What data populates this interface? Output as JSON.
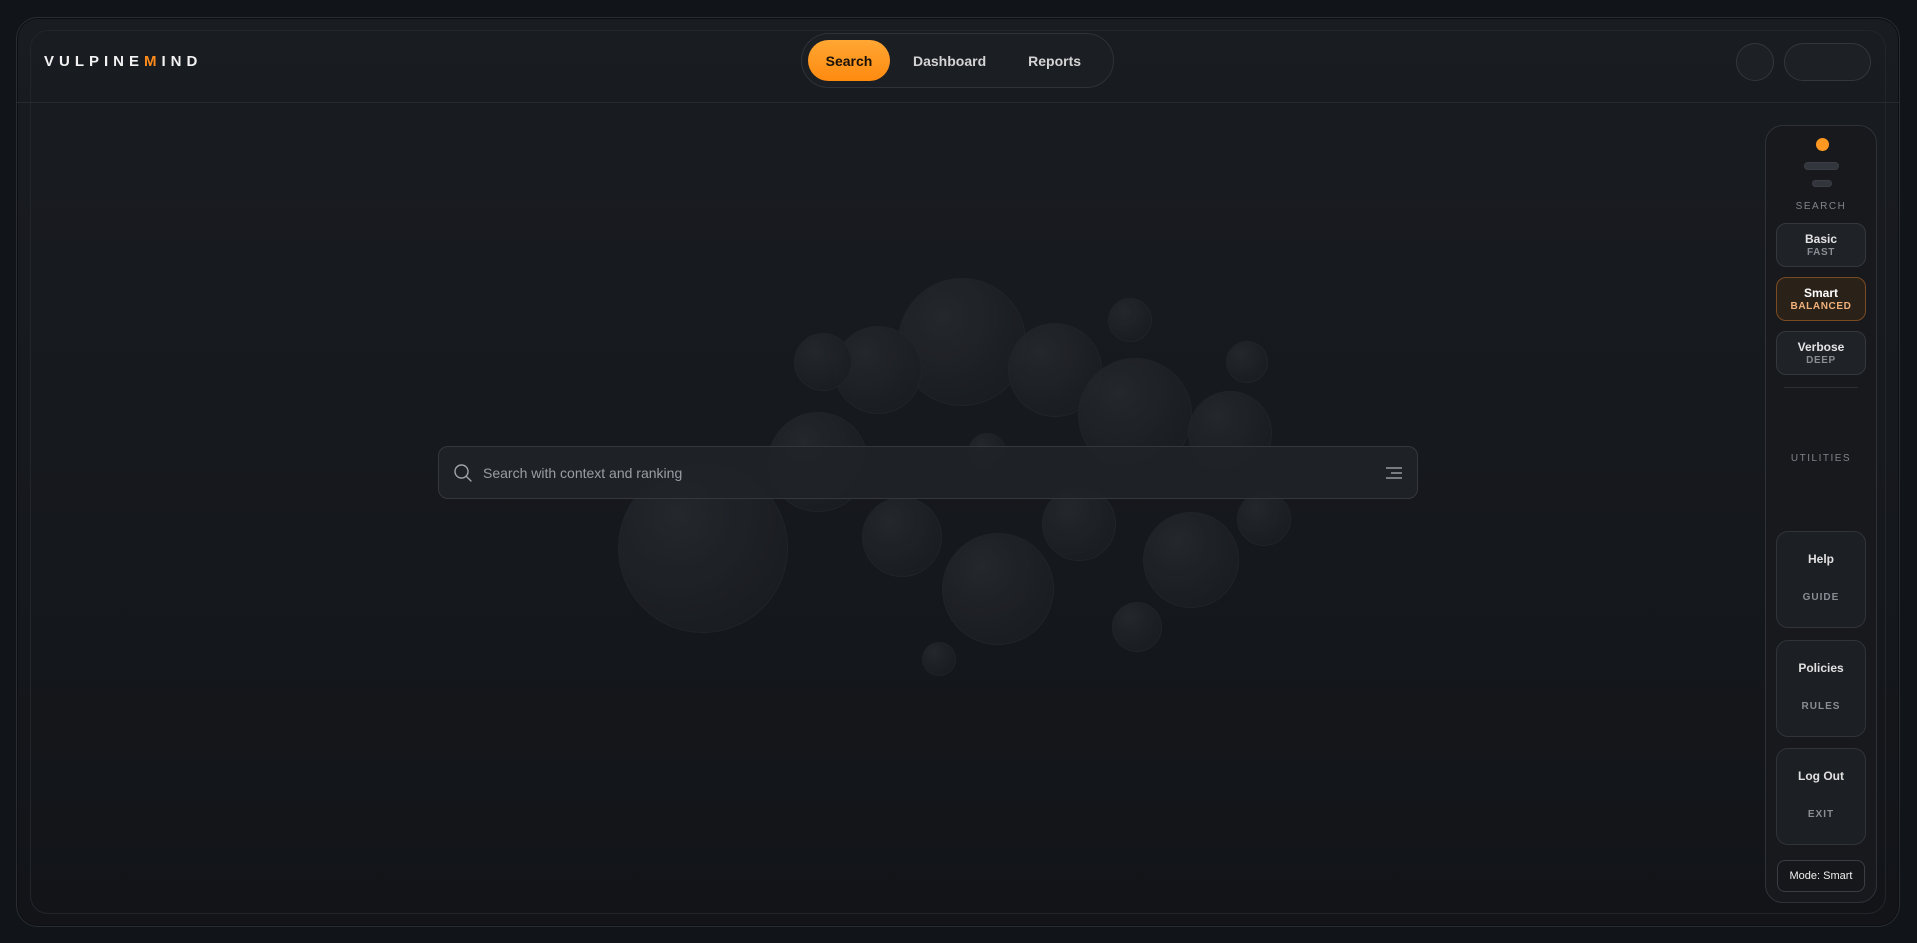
{
  "brand": {
    "name_part1": "VULPINE",
    "name_accent": "M",
    "name_part2": "IND",
    "accent_color": "#ff8c1a"
  },
  "nav": {
    "tabs": [
      {
        "label": "Search",
        "active": true
      },
      {
        "label": "Dashboard",
        "active": false
      },
      {
        "label": "Reports",
        "active": false
      }
    ]
  },
  "search": {
    "placeholder": "Search with context and ranking",
    "value": ""
  },
  "sidebar": {
    "search_section_label": "SEARCH",
    "modes": [
      {
        "title": "Basic",
        "subtitle": "FAST",
        "active": false
      },
      {
        "title": "Smart",
        "subtitle": "BALANCED",
        "active": true
      },
      {
        "title": "Verbose",
        "subtitle": "DEEP",
        "active": false
      }
    ],
    "utilities_section_label": "UTILITIES",
    "utilities": [
      {
        "title": "Help",
        "subtitle": "GUIDE"
      },
      {
        "title": "Policies",
        "subtitle": "RULES"
      },
      {
        "title": "Log Out",
        "subtitle": "EXIT"
      }
    ],
    "mode_status": "Mode: Smart"
  },
  "icons": {
    "search": "search-icon",
    "filter": "filter-lines-icon",
    "status_dot": "status-dot-icon"
  }
}
